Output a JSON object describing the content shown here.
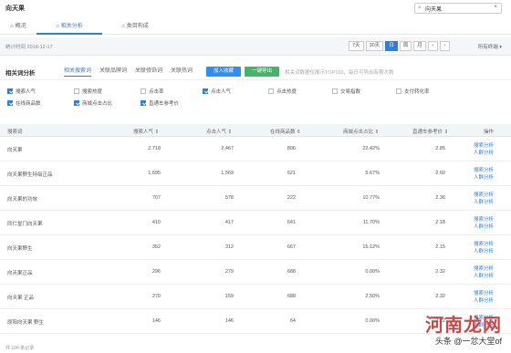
{
  "app": {
    "title": "向天果"
  },
  "search": {
    "value": "向天果",
    "clear_icon": "×"
  },
  "tabs": [
    {
      "label": "概况",
      "icon": "home-icon"
    },
    {
      "label": "相关分析",
      "icon": "home-icon"
    },
    {
      "label": "类目构成",
      "icon": "home-icon"
    }
  ],
  "datebar": {
    "stat_time": "统计时间 2018-12-17",
    "buttons": [
      "7天",
      "30天",
      "日",
      "周",
      "月",
      "‹",
      "›"
    ],
    "active": "日",
    "terminal": "所有终端"
  },
  "section": {
    "title": "相关词分析",
    "subtabs": [
      "相关搜索词",
      "关联品牌词",
      "关联修饰词",
      "关联热词"
    ],
    "active_subtab": "相关搜索词",
    "btn_blue": "加入收藏",
    "btn_green": "一键导出",
    "tip": "相关词数据仅展示TOP100，每日可导出有限次数"
  },
  "checkboxes": [
    {
      "label": "搜索人气",
      "checked": true
    },
    {
      "label": "搜索热度",
      "checked": false
    },
    {
      "label": "点击率",
      "checked": false
    },
    {
      "label": "点击人气",
      "checked": true
    },
    {
      "label": "点击热度",
      "checked": false
    },
    {
      "label": "交易指数",
      "checked": false
    },
    {
      "label": "支付转化率",
      "checked": false
    },
    {
      "label": "在线商品数",
      "checked": true
    },
    {
      "label": "商城点击占比",
      "checked": true
    },
    {
      "label": "直通车参考价",
      "checked": true
    }
  ],
  "table": {
    "headers": [
      "搜索词",
      "搜索人气 ⇕",
      "点击人气 ⇕",
      "在线商品数 ⇕",
      "商城点击占比 ⇕",
      "直通车参考价 ⇕",
      "操作"
    ],
    "op_labels": [
      "搜索分析",
      "人群分析"
    ],
    "rows": [
      [
        "向天果",
        "2,718",
        "2,467",
        "806",
        "22.42%",
        "2.85"
      ],
      [
        "向天果野生特级正品",
        "1,695",
        "1,569",
        "621",
        "5.67%",
        "2.60"
      ],
      [
        "向天果的功效",
        "707",
        "578",
        "222",
        "10.77%",
        "2.36"
      ],
      [
        "同仁堂门向天果",
        "410",
        "417",
        "641",
        "11.70%",
        "2.18"
      ],
      [
        "向天果野生",
        "352",
        "312",
        "667",
        "15.12%",
        "2.15"
      ],
      [
        "向天果正品",
        "296",
        "279",
        "688",
        "0.00%",
        "2.32"
      ],
      [
        "向天果 正品",
        "270",
        "159",
        "688",
        "2.50%",
        "2.32"
      ],
      [
        "原阳向天果 野生",
        "146",
        "146",
        "64",
        "0.00%",
        "2.22"
      ]
    ]
  },
  "pager": "共 100 条记录",
  "watermark": {
    "big": "河南龙网",
    "small": "头条 @一忿大堂of"
  }
}
